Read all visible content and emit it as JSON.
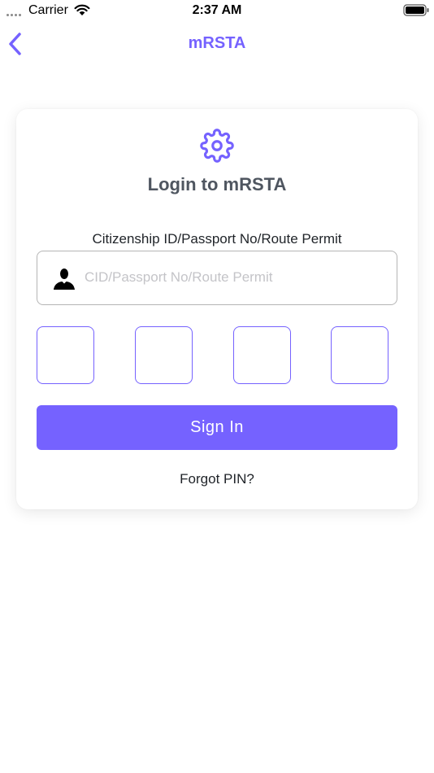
{
  "status_bar": {
    "carrier": "Carrier",
    "time": "2:37 AM",
    "icons": [
      "signal-dots-icon",
      "wifi-icon",
      "battery-icon"
    ]
  },
  "nav": {
    "title": "mRSTA",
    "back_icon": "chevron-left-icon"
  },
  "card": {
    "icon": "gear-icon",
    "title": "Login to mRSTA",
    "id_label": "Citizenship ID/Passport No/Route Permit",
    "id_input": {
      "icon": "user-icon",
      "value": "",
      "placeholder": "CID/Passport No/Route Permit"
    },
    "pin_boxes": [
      "",
      "",
      "",
      ""
    ],
    "sign_in_label": "Sign In",
    "forgot_pin_label": "Forgot PIN?"
  },
  "colors": {
    "accent": "#7562ff",
    "title_text": "#4f5660",
    "placeholder": "#c4c4c8",
    "input_border": "#b5b5b5"
  }
}
